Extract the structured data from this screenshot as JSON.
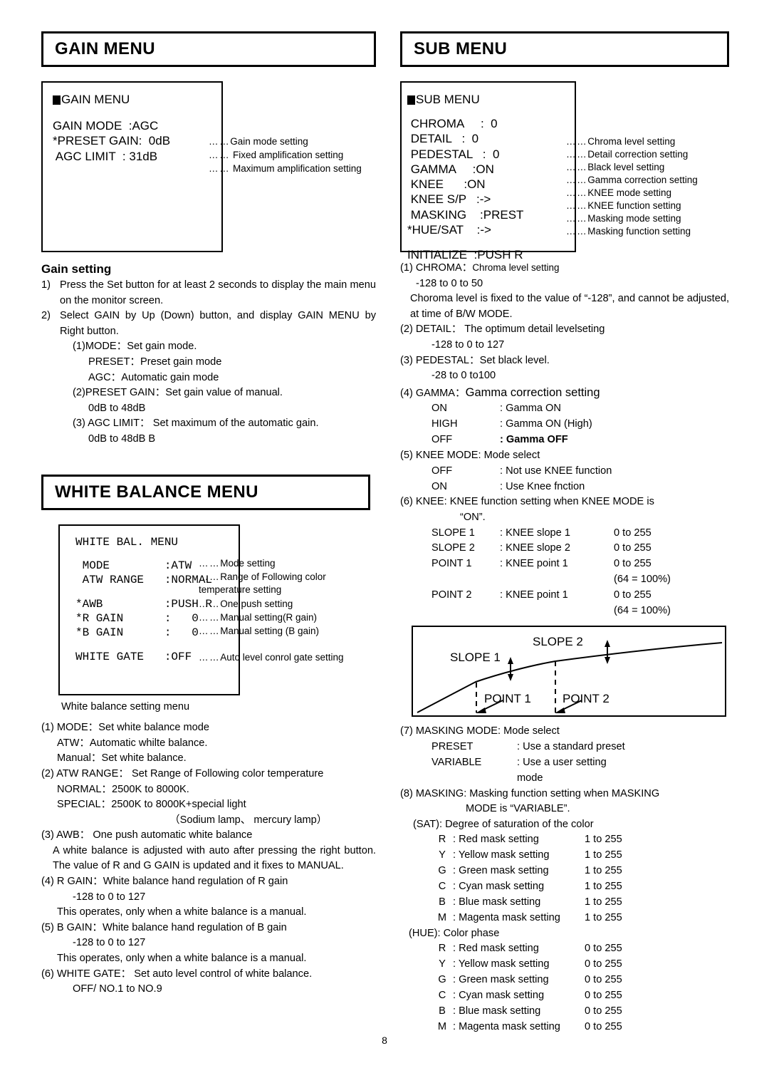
{
  "page": {
    "number": "8"
  },
  "gain": {
    "banner": "GAIN MENU",
    "osd": {
      "title": "GAIN MENU",
      "lines": [
        "GAIN MODE  :AGC",
        "*PRESET GAIN:  0dB",
        " AGC LIMIT  : 31dB"
      ],
      "annotations": [
        {
          "dots": "……",
          "text": "Gain mode setting"
        },
        {
          "dots": "……",
          "text": " Fixed amplification setting"
        },
        {
          "dots": "……",
          "text": " Maximum amplification setting"
        }
      ]
    },
    "heading": "Gain setting",
    "steps": [
      {
        "num": "1)",
        "text": "Press the Set button for at least 2 seconds to display the main menu on the monitor screen."
      },
      {
        "num": "2)",
        "text": "Select GAIN by Up (Down) button, and display GAIN MENU by Right button."
      }
    ],
    "sub": [
      "(1)MODE：Set gain mode.",
      "PRESET：Preset gain mode",
      "AGC：Automatic gain mode",
      "(2)PRESET GAIN：Set gain value of manual.",
      "0dB to 48dB",
      "(3) AGC LIMIT：   Set maximum of the automatic gain.",
      "0dB to 48dB B"
    ]
  },
  "white_balance": {
    "banner": "WHITE BALANCE MENU",
    "osd": {
      "title": "WHITE BAL. MENU",
      "lines": [
        " MODE        :ATW",
        " ATW RANGE   :NORMAL",
        "",
        "*AWB         :PUSH R",
        "*R GAIN      :   0",
        "*B GAIN      :   0",
        "",
        "WHITE GATE   :OFF"
      ],
      "annotations": [
        {
          "dots": "……",
          "text": "Mode setting"
        },
        {
          "dots": "……",
          "text": "Range  of  Following   color temperature setting"
        },
        {
          "dots": "……",
          "text": "One push setting"
        },
        {
          "dots": "……",
          "text": "Manual setting(R gain)"
        },
        {
          "dots": "……",
          "text": "Manual setting (B gain)"
        },
        {
          "dots": "……",
          "text": "Auto level conrol gate setting"
        }
      ]
    },
    "caption": "White balance setting menu",
    "items": [
      "(1) MODE：Set white balance mode",
      "ATW：Automatic whilte balance.",
      "Manual：Set white balance.",
      "(2) ATW RANGE：   Set Range of Following color temperature",
      "NORMAL：2500K to 8000K.",
      "SPECIAL：2500K to 8000K+special light",
      "（Sodium lamp、 mercury lamp）",
      "(3) AWB：    One push automatic white balance",
      "A white balance is adjusted with auto after pressing the right button. The value of R and G GAIN is updated and it fixes to MANUAL.",
      "(4) R GAIN：White balance hand regulation of R gain",
      "-128 to 0 to 127",
      "This operates, only when a white balance is a manual.",
      "(5) B GAIN：White balance hand regulation of B gain",
      "-128 to 0 to 127",
      "This operates, only when a white balance is a manual.",
      "(6) WHITE GATE：  Set auto level control of white balance.",
      "OFF/ NO.1 to NO.9"
    ]
  },
  "sub_menu": {
    "banner": "SUB MENU",
    "osd": {
      "title": "SUB MENU",
      "lines": [
        " CHROMA     :  0",
        " DETAIL   :  0",
        " PEDESTAL   :  0",
        " GAMMA     :ON",
        " KNEE      :ON",
        " KNEE S/P   :->",
        " MASKING    :PREST",
        "*HUE/SAT    :->",
        "",
        "INITIALIZE  :PUSH R"
      ],
      "annotations": [
        {
          "dots": "……",
          "text": "Chroma level setting"
        },
        {
          "dots": "……",
          "text": "Detail correction setting"
        },
        {
          "dots": "……",
          "text": "Black level setting"
        },
        {
          "dots": "……",
          "text": "Gamma correction setting"
        },
        {
          "dots": "……",
          "text": "KNEE mode setting"
        },
        {
          "dots": "……",
          "text": "KNEE function setting"
        },
        {
          "dots": "……",
          "text": "Masking mode setting"
        },
        {
          "dots": "……",
          "text": "Masking function setting"
        }
      ]
    },
    "item1_label": "(1) CHROMA：",
    "item1_desc": "Chroma level setting",
    "item1_range": "-128 to 0 to 50",
    "item1_note": "Choroma level is fixed to the value of “-128”, and cannot be adjusted, at time of B/W MODE.",
    "item2": "(2) DETAIL：  The optimum detail levelseting",
    "item2_range": "-128 to 0 to 127",
    "item3": "(3) PEDESTAL：Set black level.",
    "item3_range": "-28 to 0 to100",
    "item4_label": "(4) GAMMA：",
    "item4_desc": "Gamma correction setting",
    "gamma_rows": [
      {
        "name": "ON",
        "sep": ": Gamma ON"
      },
      {
        "name": "HIGH",
        "sep": ": Gamma ON (High)"
      },
      {
        "name": "OFF",
        "sep": ": Gamma OFF"
      }
    ],
    "item5": "(5) KNEE MODE: Mode select",
    "knee_mode_rows": [
      {
        "name": "OFF",
        "sep": ": Not use KNEE function"
      },
      {
        "name": "ON",
        "sep": ": Use Knee fnction"
      }
    ],
    "item6": "(6)  KNEE:  KNEE  function  setting  when  KNEE  MODE  is",
    "item6b": "“ON”.",
    "knee_rows": [
      {
        "c1": "SLOPE 1",
        "c2": ": KNEE slope 1",
        "c3": "0 to 255",
        "sub": ""
      },
      {
        "c1": "SLOPE 2",
        "c2": ": KNEE slope 2",
        "c3": "0 to 255",
        "sub": ""
      },
      {
        "c1": "POINT 1",
        "c2": ": KNEE point 1",
        "c3": "0 to 255",
        "sub": "(64 = 100%)"
      },
      {
        "c1": "POINT 2",
        "c2": ": KNEE point 1",
        "c3": "0 to 255",
        "sub": "(64 = 100%)"
      }
    ],
    "figure": {
      "slope1_label": "SLOPE 1",
      "slope2_label": "SLOPE 2",
      "point1_label": "POINT 1",
      "point2_label": "POINT 2"
    },
    "item7": "(7) MASKING MODE: Mode select",
    "masking_mode_rows": [
      {
        "name": "PRESET",
        "sep": ": Use a standard preset"
      },
      {
        "name": "VARIABLE",
        "sep": ": Use a user setting mode"
      }
    ],
    "item8": "(8)  MASKING:  Masking  function  setting  when  MASKING",
    "item8b": "MODE is “VARIABLE”.",
    "sat_header": "(SAT): Degree of saturation of the color",
    "sat_rows": [
      {
        "m1": "R",
        "m2": ": Red mask setting",
        "m3": "1 to 255"
      },
      {
        "m1": "Y",
        "m2": ": Yellow mask setting",
        "m3": "1 to 255"
      },
      {
        "m1": "G",
        "m2": ": Green mask setting",
        "m3": "1 to 255"
      },
      {
        "m1": "C",
        "m2": ": Cyan mask setting",
        "m3": "1 to 255"
      },
      {
        "m1": "B",
        "m2": ": Blue mask setting",
        "m3": "1 to 255"
      },
      {
        "m1": "M",
        "m2": ": Magenta mask setting",
        "m3": "1 to 255"
      }
    ],
    "hue_header": "(HUE): Color phase",
    "hue_rows": [
      {
        "m1": "R",
        "m2": ": Red mask setting",
        "m3": "0 to 255"
      },
      {
        "m1": "Y",
        "m2": ": Yellow mask setting",
        "m3": "0 to 255"
      },
      {
        "m1": "G",
        "m2": ": Green mask setting",
        "m3": "0 to 255"
      },
      {
        "m1": "C",
        "m2": ": Cyan mask setting",
        "m3": "0 to 255"
      },
      {
        "m1": "B",
        "m2": ": Blue mask setting",
        "m3": "0 to 255"
      },
      {
        "m1": "M",
        "m2": ": Magenta mask setting",
        "m3": "0 to 255"
      }
    ]
  }
}
